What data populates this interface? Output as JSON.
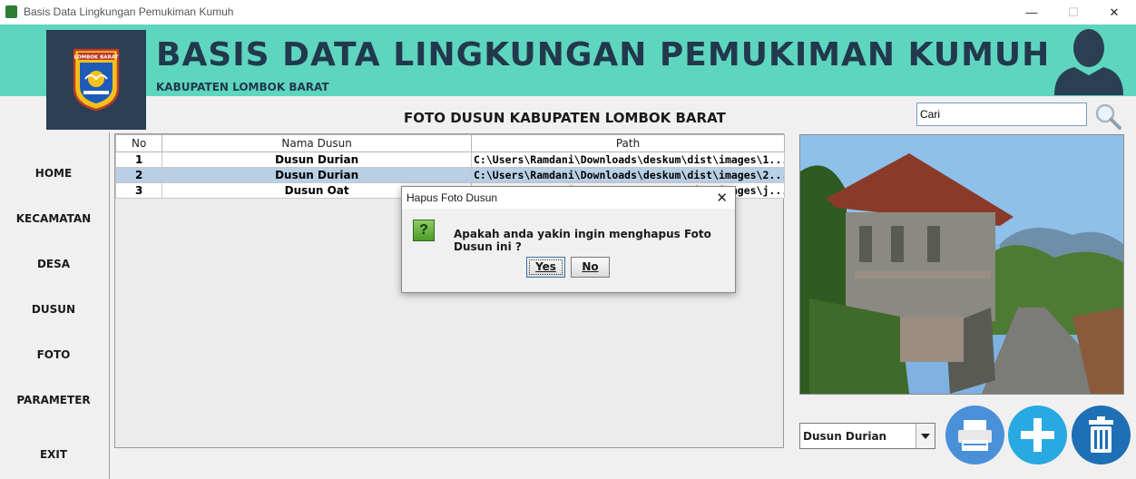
{
  "window": {
    "title": "Basis Data Lingkungan Pemukiman Kumuh",
    "minimize": "—",
    "maximize": "☐",
    "close": "✕"
  },
  "header": {
    "title": "BASIS DATA LINGKUNGAN PEMUKIMAN KUMUH",
    "subtitle": "KABUPATEN LOMBOK BARAT",
    "logo_text": "LOMBOK BARAT",
    "band_color": "#5ed6bf",
    "dark_color": "#2a3f53"
  },
  "page": {
    "heading": "FOTO DUSUN KABUPATEN LOMBOK BARAT"
  },
  "search": {
    "value": "Cari"
  },
  "sidebar": {
    "items": [
      {
        "label": "HOME"
      },
      {
        "label": "KECAMATAN"
      },
      {
        "label": "DESA"
      },
      {
        "label": "DUSUN"
      },
      {
        "label": "FOTO"
      },
      {
        "label": "PARAMETER"
      },
      {
        "label": "EXIT"
      }
    ]
  },
  "table": {
    "columns": [
      "No",
      "Nama Dusun",
      "Path"
    ],
    "rows": [
      {
        "no": "1",
        "name": "Dusun Durian",
        "path": "C:\\Users\\Ramdani\\Downloads\\deskum\\dist\\images\\1..."
      },
      {
        "no": "2",
        "name": "Dusun Durian",
        "path": "C:\\Users\\Ramdani\\Downloads\\deskum\\dist\\images\\2..."
      },
      {
        "no": "3",
        "name": "Dusun Oat",
        "path": "C:\\Users\\Ramdani\\Downloads\\deskum\\dist\\images\\j..."
      }
    ],
    "selected_row": 2
  },
  "dusun_select": {
    "value": "Dusun Durian"
  },
  "actions": {
    "print_color": "#4a90d9",
    "add_color": "#29a9e1",
    "delete_color": "#1e6fb5"
  },
  "dialog": {
    "title": "Hapus Foto Dusun",
    "message": "Apakah anda yakin ingin menghapus Foto Dusun ini ?",
    "yes_label": "Yes",
    "no_label": "No",
    "close": "✕"
  }
}
